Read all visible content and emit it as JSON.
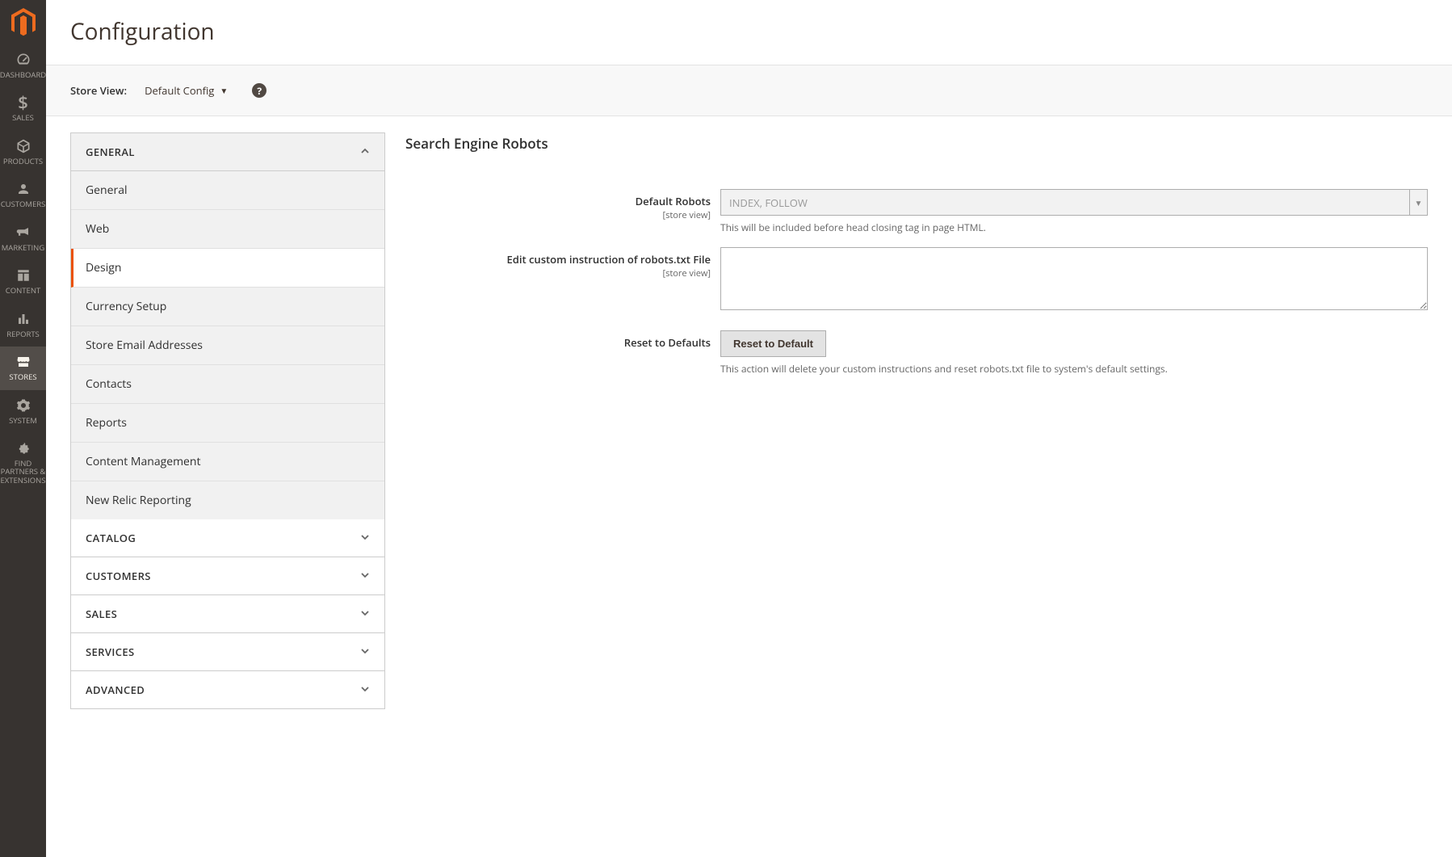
{
  "nav": {
    "items": [
      {
        "label": "DASHBOARD"
      },
      {
        "label": "SALES"
      },
      {
        "label": "PRODUCTS"
      },
      {
        "label": "CUSTOMERS"
      },
      {
        "label": "MARKETING"
      },
      {
        "label": "CONTENT"
      },
      {
        "label": "REPORTS"
      },
      {
        "label": "STORES"
      },
      {
        "label": "SYSTEM"
      },
      {
        "label": "FIND PARTNERS & EXTENSIONS"
      }
    ]
  },
  "page": {
    "title": "Configuration"
  },
  "scope": {
    "label": "Store View:",
    "value": "Default Config"
  },
  "tabs": {
    "groups": [
      {
        "title": "GENERAL",
        "expanded": true,
        "items": [
          "General",
          "Web",
          "Design",
          "Currency Setup",
          "Store Email Addresses",
          "Contacts",
          "Reports",
          "Content Management",
          "New Relic Reporting"
        ],
        "active_index": 2
      },
      {
        "title": "CATALOG",
        "expanded": false
      },
      {
        "title": "CUSTOMERS",
        "expanded": false
      },
      {
        "title": "SALES",
        "expanded": false
      },
      {
        "title": "SERVICES",
        "expanded": false
      },
      {
        "title": "ADVANCED",
        "expanded": false
      }
    ]
  },
  "section": {
    "title": "Search Engine Robots",
    "fields": {
      "default_robots": {
        "label": "Default Robots",
        "scope": "[store view]",
        "value": "INDEX, FOLLOW",
        "note": "This will be included before head closing tag in page HTML."
      },
      "custom_instructions": {
        "label": "Edit custom instruction of robots.txt File",
        "scope": "[store view]",
        "value": ""
      },
      "reset": {
        "label": "Reset to Defaults",
        "button": "Reset to Default",
        "note": "This action will delete your custom instructions and reset robots.txt file to system's default settings."
      }
    }
  }
}
